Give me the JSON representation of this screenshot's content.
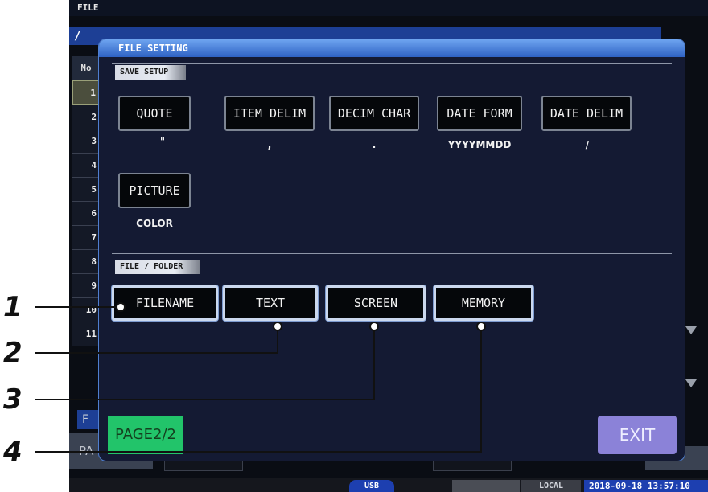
{
  "screen": {
    "top_title": "FILE",
    "path": "/",
    "table_header": "No",
    "rows": [
      "1",
      "2",
      "3",
      "4",
      "5",
      "6",
      "7",
      "8",
      "9",
      "10",
      "11"
    ],
    "left_tab_fragment": "F",
    "left_button_fragment": "PA"
  },
  "dialog": {
    "title": "FILE SETTING",
    "save_setup": {
      "label": "SAVE SETUP",
      "buttons": [
        {
          "label": "QUOTE",
          "value": "\""
        },
        {
          "label": "ITEM DELIM",
          "value": ","
        },
        {
          "label": "DECIM CHAR",
          "value": "."
        },
        {
          "label": "DATE FORM",
          "value": "YYYYMMDD"
        },
        {
          "label": "DATE DELIM",
          "value": "/"
        }
      ],
      "picture": {
        "label": "PICTURE",
        "value": "COLOR"
      }
    },
    "file_folder": {
      "label": "FILE / FOLDER",
      "buttons": [
        "FILENAME",
        "TEXT",
        "SCREEN",
        "MEMORY"
      ]
    },
    "page_button": "PAGE2/2",
    "exit_button": "EXIT"
  },
  "status": {
    "usb": "USB",
    "local": "LOCAL",
    "datetime": "2018-09-18 13:57:10"
  },
  "callouts": [
    "1",
    "2",
    "3",
    "4"
  ],
  "colors": {
    "accent_blue": "#1d3f95",
    "title_gradient_top": "#6ea4f0",
    "page_button": "#22c46a",
    "exit_button": "#8b82d8",
    "highlight_border": "#cbd8ee"
  }
}
